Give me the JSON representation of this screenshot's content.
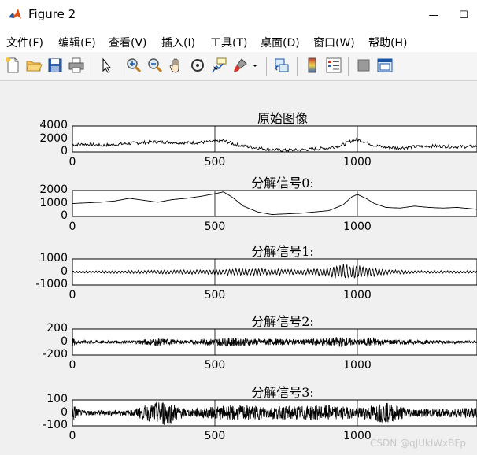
{
  "window": {
    "title": "Figure 2",
    "controls": {
      "minimize": "—",
      "maximize": "☐"
    }
  },
  "menu": [
    "文件(F)",
    "编辑(E)",
    "查看(V)",
    "插入(I)",
    "工具(T)",
    "桌面(D)",
    "窗口(W)",
    "帮助(H)"
  ],
  "toolbar_icons": [
    "new-figure",
    "open-file",
    "save",
    "print",
    "pointer",
    "zoom-in",
    "zoom-out",
    "pan",
    "rotate-3d",
    "data-cursor",
    "brush",
    "brush-dropdown",
    "link-plot",
    "colorbar",
    "legend",
    "hide-plot-tools",
    "show-plot-tools"
  ],
  "colors": {
    "background": "#f0f0f0",
    "axes_bg": "#ffffff",
    "line": "#000000",
    "grid": "#d0d0d0"
  },
  "watermark": "CSDN @qJUklWxBFp",
  "chart_data": [
    {
      "type": "line",
      "title": "原始图像",
      "ylim": [
        0,
        4000
      ],
      "yticks": [
        "4000",
        "2000",
        "0"
      ],
      "yticks_values": [
        4000,
        2000,
        0
      ],
      "xticks": [
        "0",
        "500",
        "1000"
      ],
      "xticks_values": [
        0,
        500,
        1000
      ],
      "xlim": [
        0,
        1420
      ],
      "grid": "vertical only",
      "series": [
        {
          "x": [
            0,
            50,
            100,
            150,
            200,
            250,
            300,
            350,
            400,
            450,
            500,
            530,
            560,
            600,
            650,
            700,
            750,
            800,
            850,
            900,
            950,
            980,
            1000,
            1030,
            1060,
            1100,
            1150,
            1200,
            1250,
            1300,
            1350,
            1400,
            1420
          ],
          "y": [
            1100,
            1200,
            1000,
            1150,
            1300,
            1450,
            1550,
            1500,
            1400,
            1450,
            1600,
            1750,
            1300,
            900,
            600,
            350,
            250,
            300,
            450,
            600,
            1100,
            1700,
            1900,
            1500,
            1000,
            700,
            600,
            800,
            900,
            850,
            800,
            850,
            900
          ]
        }
      ]
    },
    {
      "type": "line",
      "title": "分解信号0:",
      "ylim": [
        0,
        2000
      ],
      "yticks": [
        "2000",
        "1000",
        "0"
      ],
      "yticks_values": [
        2000,
        1000,
        0
      ],
      "xticks": [
        "0",
        "500",
        "1000"
      ],
      "xticks_values": [
        0,
        500,
        1000
      ],
      "xlim": [
        0,
        1420
      ],
      "grid": "vertical only",
      "series": [
        {
          "x": [
            0,
            50,
            100,
            150,
            200,
            250,
            300,
            350,
            400,
            450,
            500,
            530,
            560,
            600,
            650,
            700,
            750,
            800,
            850,
            900,
            950,
            980,
            1000,
            1030,
            1060,
            1100,
            1150,
            1200,
            1250,
            1300,
            1350,
            1400,
            1420
          ],
          "y": [
            1000,
            1050,
            1100,
            1200,
            1400,
            1250,
            1100,
            1300,
            1400,
            1550,
            1750,
            1900,
            1500,
            800,
            350,
            150,
            200,
            250,
            350,
            450,
            900,
            1500,
            1700,
            1400,
            1000,
            700,
            650,
            800,
            700,
            650,
            700,
            600,
            550
          ]
        }
      ]
    },
    {
      "type": "line",
      "title": "分解信号1:",
      "ylim": [
        -1000,
        1000
      ],
      "yticks": [
        "1000",
        "0",
        "-1000"
      ],
      "yticks_values": [
        1000,
        0,
        -1000
      ],
      "xticks": [
        "0",
        "500",
        "1000"
      ],
      "xticks_values": [
        0,
        500,
        1000
      ],
      "xlim": [
        0,
        1420
      ],
      "grid": "vertical only",
      "series": [
        {
          "name": "oscillation",
          "amplitude_envelope": [
            [
              0,
              80
            ],
            [
              300,
              150
            ],
            [
              500,
              200
            ],
            [
              600,
              300
            ],
            [
              700,
              250
            ],
            [
              800,
              200
            ],
            [
              900,
              350
            ],
            [
              950,
              700
            ],
            [
              1000,
              500
            ],
            [
              1030,
              450
            ],
            [
              1100,
              200
            ],
            [
              1200,
              120
            ],
            [
              1420,
              100
            ]
          ]
        }
      ]
    },
    {
      "type": "line",
      "title": "分解信号2:",
      "ylim": [
        -200,
        200
      ],
      "yticks": [
        "200",
        "0",
        "-200"
      ],
      "yticks_values": [
        200,
        0,
        -200
      ],
      "xticks": [
        "0",
        "500",
        "1000"
      ],
      "xticks_values": [
        0,
        500,
        1000
      ],
      "xlim": [
        0,
        1420
      ],
      "grid": "vertical only",
      "series": [
        {
          "name": "noise",
          "amplitude_envelope": [
            [
              0,
              60
            ],
            [
              20,
              30
            ],
            [
              200,
              20
            ],
            [
              300,
              60
            ],
            [
              400,
              25
            ],
            [
              560,
              70
            ],
            [
              650,
              50
            ],
            [
              800,
              40
            ],
            [
              950,
              80
            ],
            [
              1000,
              40
            ],
            [
              1050,
              70
            ],
            [
              1100,
              40
            ],
            [
              1420,
              20
            ]
          ]
        }
      ]
    },
    {
      "type": "line",
      "title": "分解信号3:",
      "ylim": [
        -100,
        100
      ],
      "yticks": [
        "100",
        "0",
        "-100"
      ],
      "yticks_values": [
        100,
        0,
        -100
      ],
      "xticks": [
        "0",
        "500",
        "1000"
      ],
      "xticks_values": [
        0,
        500,
        1000
      ],
      "xlim": [
        0,
        1420
      ],
      "grid": "vertical only",
      "series": [
        {
          "name": "noise",
          "amplitude_envelope": [
            [
              0,
              70
            ],
            [
              30,
              20
            ],
            [
              200,
              20
            ],
            [
              320,
              100
            ],
            [
              400,
              30
            ],
            [
              560,
              60
            ],
            [
              700,
              50
            ],
            [
              900,
              60
            ],
            [
              1000,
              40
            ],
            [
              1100,
              80
            ],
            [
              1200,
              30
            ],
            [
              1420,
              40
            ]
          ]
        }
      ]
    }
  ]
}
